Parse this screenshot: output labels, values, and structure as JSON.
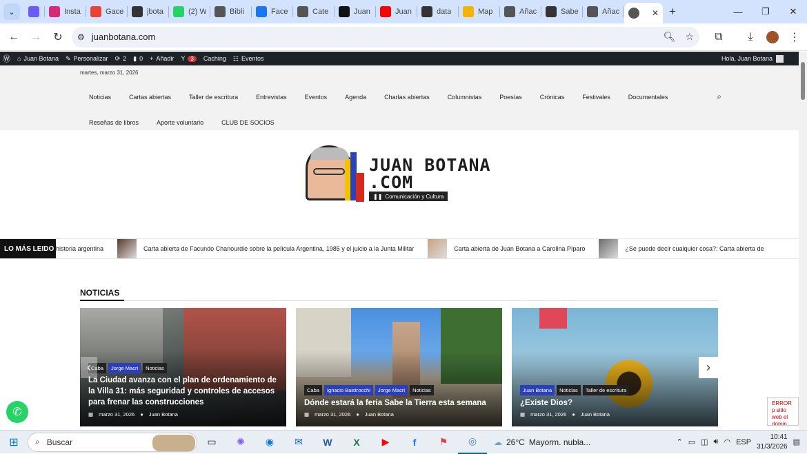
{
  "browser": {
    "tabs": [
      {
        "label": "",
        "icon": "copilot-icon",
        "color": "#6b5bff"
      },
      {
        "label": "Insta",
        "icon": "instagram-icon",
        "color": "#d62976"
      },
      {
        "label": "Gace",
        "icon": "gmail-icon",
        "color": "#ea4335"
      },
      {
        "label": "jbota",
        "icon": "jb-icon",
        "color": "#333333"
      },
      {
        "label": "(2) W",
        "icon": "whatsapp-icon",
        "color": "#25d366"
      },
      {
        "label": "Bibli",
        "icon": "globe-icon",
        "color": "#555555"
      },
      {
        "label": "Face",
        "icon": "facebook-icon",
        "color": "#1877f2"
      },
      {
        "label": "Cate",
        "icon": "globe-icon",
        "color": "#555555"
      },
      {
        "label": "Juan",
        "icon": "x-icon",
        "color": "#111111"
      },
      {
        "label": "Juan",
        "icon": "youtube-icon",
        "color": "#ff0000"
      },
      {
        "label": "data",
        "icon": "jb-icon",
        "color": "#333333"
      },
      {
        "label": "Map",
        "icon": "maps-icon",
        "color": "#f5b400"
      },
      {
        "label": "Añac",
        "icon": "globe-icon",
        "color": "#555555"
      },
      {
        "label": "Sabe",
        "icon": "jb-icon",
        "color": "#333333"
      },
      {
        "label": "Añac",
        "icon": "globe-icon",
        "color": "#555555"
      }
    ],
    "active_tab_close": "✕",
    "url": "juanbotana.com"
  },
  "wpbar": {
    "site": "Juan Botana",
    "customize": "Personalizar",
    "updates": "2",
    "comments": "0",
    "add": "Añadir",
    "yoast_count": "3",
    "caching": "Caching",
    "events": "Eventos",
    "greeting": "Hola, Juan Botana"
  },
  "site": {
    "date": "martes, marzo 31, 2026",
    "nav_row1": [
      "Noticias",
      "Cartas abiertas",
      "Taller de escritura",
      "Entrevistas",
      "Eventos",
      "Agenda",
      "Charlas abiertas",
      "Columnistas",
      "Poesías",
      "Crónicas",
      "Festivales",
      "Documentales"
    ],
    "nav_row2": [
      "Reseñas de libros",
      "Aporte voluntario",
      "CLUB DE SOCIOS"
    ],
    "logo_line1": "JUAN BOTANA",
    "logo_line2": ".COM",
    "logo_tagline": "Comunicación y Cultura"
  },
  "ticker": {
    "label": "LO MÁS LEIDO",
    "items": [
      {
        "text": "historia argentina",
        "thumb": false
      },
      {
        "text": "Carta abierta de Facundo Chanourdie sobre la película Argentina, 1985 y el juicio a la Junta Militar",
        "thumb": true
      },
      {
        "text": "Carta abierta de Juan Botana a Carolina Píparo",
        "thumb": true
      },
      {
        "text": "¿Se puede decir cualquier cosa?: Carta abierta de",
        "thumb": true
      }
    ]
  },
  "news": {
    "section_title": "NOTICIAS",
    "cards": [
      {
        "cats": [
          {
            "t": "Caba",
            "blue": false
          },
          {
            "t": "Jorge Macri",
            "blue": true
          },
          {
            "t": "Noticias",
            "blue": false
          }
        ],
        "title": "La Ciudad avanza con el plan de ordenamiento de la Villa 31: más seguridad y controles de accesos para frenar las construcciones",
        "date": "marzo 31, 2026",
        "author": "Juan Botana"
      },
      {
        "cats": [
          {
            "t": "Caba",
            "blue": false
          },
          {
            "t": "Ignacio Baistrocchi",
            "blue": true
          },
          {
            "t": "Jorge Macri",
            "blue": true
          },
          {
            "t": "Noticias",
            "blue": false
          }
        ],
        "title": "Dónde estará la feria Sabe la Tierra esta semana",
        "date": "marzo 31, 2026",
        "author": "Juan Botana"
      },
      {
        "cats": [
          {
            "t": "Juan Botana",
            "blue": true
          },
          {
            "t": "Noticias",
            "blue": false
          },
          {
            "t": "Taller de escritura",
            "blue": false
          }
        ],
        "title": "¿Existe Dios?",
        "date": "marzo 31, 2026",
        "author": "Juan Botana"
      }
    ]
  },
  "error_box": "ERROR p sitio web el domin",
  "taskbar": {
    "search_placeholder": "Buscar",
    "weather_temp": "26°C",
    "weather_desc": "Mayorm. nubla...",
    "lang": "ESP",
    "time": "10:41",
    "date": "31/3/2026"
  }
}
